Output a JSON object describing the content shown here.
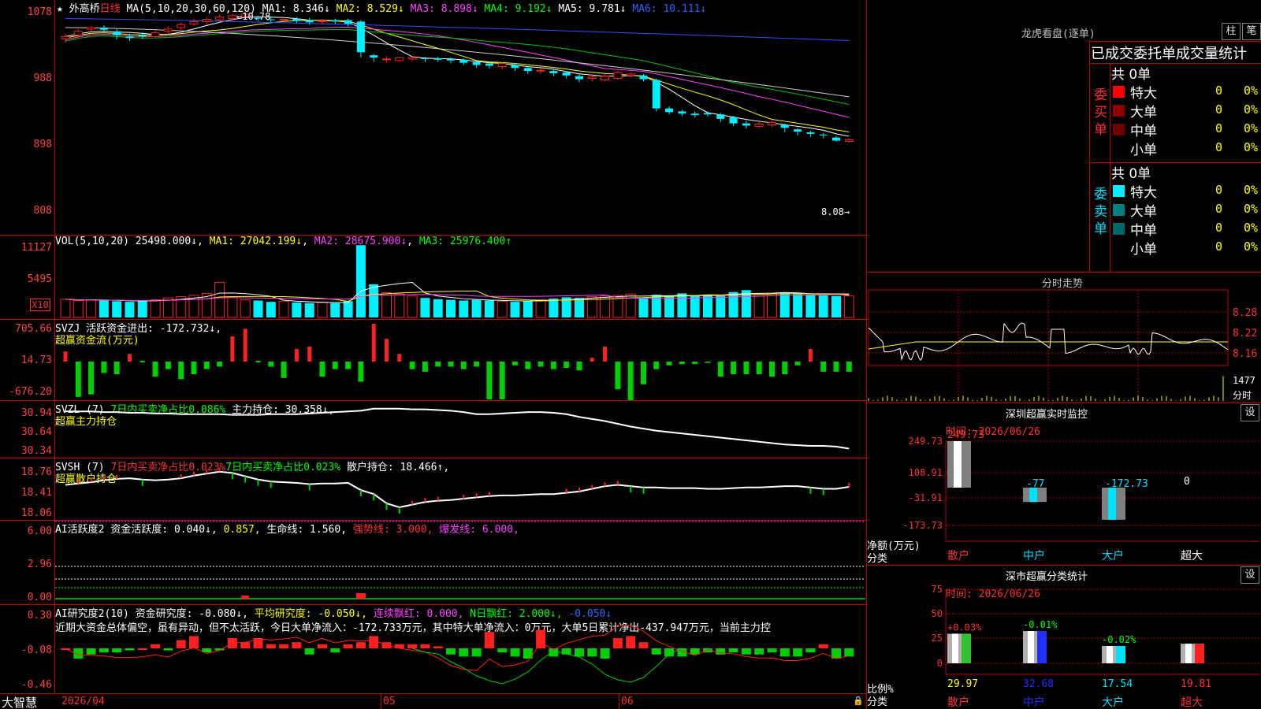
{
  "stock": {
    "star": "★",
    "name": "外高桥",
    "period": "日线",
    "ma_label": "MA(5,10,20,30,60,120)",
    "ma1": "MA1: 8.346↓",
    "ma2": "MA2: 8.529↓",
    "ma3": "MA3: 8.898↓",
    "ma4": "MA4: 9.192↓",
    "ma5": "MA5: 9.781↓",
    "ma6": "MA6: 10.111↓",
    "high_label": "10.78",
    "low_label": "8.08",
    "axis": [
      "1078",
      "988",
      "898",
      "808"
    ]
  },
  "colors": {
    "up": "#ff2020",
    "down": "#00f0ff",
    "ma1": "#ffffff",
    "ma2": "#ffff00",
    "ma3": "#ff40ff",
    "ma4": "#00c000",
    "ma5": "#d0d0d0",
    "ma6": "#3050ff"
  },
  "candles": {
    "open": [
      10.45,
      10.5,
      10.58,
      10.6,
      10.55,
      10.48,
      10.5,
      10.48,
      10.55,
      10.6,
      10.65,
      10.68,
      10.7,
      10.72,
      10.75,
      10.73,
      10.71,
      10.7,
      10.72,
      10.7,
      10.68,
      10.7,
      10.7,
      10.68,
      10.23,
      10.18,
      10.16,
      10.18,
      10.19,
      10.19,
      10.18,
      10.17,
      10.14,
      10.12,
      10.08,
      10.1,
      10.06,
      10.03,
      10.02,
      10.0,
      9.95,
      9.92,
      9.9,
      9.92,
      9.96,
      9.96,
      9.9,
      9.52,
      9.48,
      9.45,
      9.46,
      9.44,
      9.4,
      9.32,
      9.28,
      9.3,
      9.3,
      9.24,
      9.2,
      9.17,
      9.13,
      9.08
    ],
    "close": [
      10.48,
      10.55,
      10.6,
      10.57,
      10.5,
      10.46,
      10.48,
      10.53,
      10.58,
      10.64,
      10.68,
      10.71,
      10.74,
      10.76,
      10.78,
      10.72,
      10.7,
      10.71,
      10.69,
      10.67,
      10.69,
      10.68,
      10.65,
      10.27,
      10.2,
      10.18,
      10.2,
      10.2,
      10.18,
      10.17,
      10.16,
      10.13,
      10.1,
      10.09,
      10.12,
      10.06,
      10.02,
      10.03,
      9.99,
      9.96,
      9.91,
      9.94,
      9.95,
      10.0,
      9.98,
      9.91,
      9.52,
      9.47,
      9.45,
      9.43,
      9.44,
      9.38,
      9.32,
      9.29,
      9.31,
      9.33,
      9.26,
      9.21,
      9.18,
      9.16,
      9.09,
      9.1
    ],
    "high": [
      10.52,
      10.58,
      10.62,
      10.63,
      10.58,
      10.52,
      10.54,
      10.56,
      10.62,
      10.67,
      10.72,
      10.74,
      10.78,
      10.78,
      10.78,
      10.76,
      10.74,
      10.74,
      10.74,
      10.73,
      10.72,
      10.72,
      10.72,
      10.7,
      10.25,
      10.22,
      10.21,
      10.22,
      10.21,
      10.21,
      10.2,
      10.19,
      10.17,
      10.14,
      10.14,
      10.12,
      10.08,
      10.06,
      10.04,
      10.02,
      9.98,
      9.97,
      9.98,
      10.02,
      10.0,
      9.98,
      9.92,
      9.55,
      9.5,
      9.48,
      9.48,
      9.46,
      9.42,
      9.36,
      9.34,
      9.36,
      9.32,
      9.26,
      9.22,
      9.19,
      9.15,
      9.12
    ],
    "low": [
      10.4,
      10.45,
      10.54,
      10.55,
      10.44,
      10.42,
      10.45,
      10.46,
      10.52,
      10.57,
      10.62,
      10.64,
      10.67,
      10.69,
      10.7,
      10.69,
      10.66,
      10.67,
      10.66,
      10.64,
      10.64,
      10.65,
      10.62,
      10.2,
      10.14,
      10.13,
      10.14,
      10.15,
      10.14,
      10.14,
      10.12,
      10.1,
      10.06,
      10.05,
      10.04,
      10.02,
      9.98,
      9.98,
      9.95,
      9.92,
      9.87,
      9.88,
      9.88,
      9.9,
      9.93,
      9.88,
      9.48,
      9.44,
      9.42,
      9.4,
      9.41,
      9.34,
      9.28,
      9.25,
      9.26,
      9.27,
      9.2,
      9.16,
      9.14,
      9.12,
      9.08,
      9.06
    ]
  },
  "vol": {
    "label": "VOL(5,10,20)",
    "value": "25498.000↓",
    "ma1": "MA1: 27042.199↓",
    "ma2": "MA2: 28675.900↓",
    "ma3": "MA3: 25976.400↑",
    "axis": [
      "11127",
      "5495"
    ],
    "unit": "X10",
    "values": [
      2800,
      2600,
      2700,
      2600,
      2500,
      2400,
      2600,
      2700,
      3000,
      3200,
      3400,
      3700,
      5400,
      3100,
      2700,
      2600,
      2400,
      2500,
      2300,
      2200,
      2300,
      2200,
      2500,
      11100,
      5100,
      3800,
      3600,
      3300,
      3000,
      2800,
      2700,
      2600,
      2700,
      2600,
      2500,
      2400,
      2500,
      2700,
      2900,
      3100,
      3000,
      3200,
      3300,
      3400,
      3600,
      2900,
      3500,
      3300,
      3700,
      3400,
      3500,
      3300,
      3900,
      4200,
      3600,
      3700,
      3800,
      3600,
      3500,
      3400,
      3300,
      3300
    ]
  },
  "svzj": {
    "label": "SVZJ",
    "text": "活跃资金进出: -172.732↓,",
    "title": "超赢资金流(万元)",
    "axis": [
      "705.66",
      "14.73",
      "-676.20"
    ],
    "values": [
      80,
      -280,
      -260,
      -90,
      -100,
      60,
      0,
      -120,
      -60,
      -140,
      -100,
      -60,
      -40,
      200,
      260,
      0,
      -40,
      -130,
      100,
      120,
      -120,
      -60,
      -60,
      -160,
      300,
      180,
      60,
      -60,
      -80,
      -40,
      -40,
      -60,
      -40,
      -300,
      -300,
      -30,
      -60,
      -40,
      -60,
      -50,
      -70,
      30,
      120,
      -220,
      -320,
      -180,
      -60,
      -30,
      -20,
      -20,
      -10,
      -120,
      -100,
      -100,
      -100,
      -120,
      -100,
      -30,
      100,
      -80,
      -80,
      -80
    ]
  },
  "svzl": {
    "label": "SVZL (7)",
    "text1": "7日内买卖净占比0.086%",
    "text2": "主力持仓: 30.358↓,",
    "title": "超赢主力持仓",
    "axis": [
      "30.94",
      "30.64",
      "30.34"
    ],
    "values": [
      30.9,
      30.9,
      30.9,
      30.89,
      30.89,
      30.88,
      30.88,
      30.87,
      30.87,
      30.86,
      30.86,
      30.86,
      30.86,
      30.85,
      30.85,
      30.85,
      30.86,
      30.86,
      30.86,
      30.87,
      30.88,
      30.89,
      30.9,
      30.91,
      30.94,
      30.94,
      30.94,
      30.93,
      30.93,
      30.92,
      30.91,
      30.89,
      30.86,
      30.86,
      30.87,
      30.88,
      30.89,
      30.89,
      30.88,
      30.86,
      30.82,
      30.79,
      30.76,
      30.72,
      30.68,
      30.65,
      30.62,
      30.6,
      30.58,
      30.56,
      30.54,
      30.52,
      30.5,
      30.48,
      30.46,
      30.44,
      30.42,
      30.41,
      30.4,
      30.4,
      30.39,
      30.36
    ]
  },
  "svsh": {
    "label": "SVSH (7)",
    "text1": "7日内买卖净占比0.023%",
    "text2": "7日内买卖净占比0.023%",
    "text3": "散户持仓: 18.466↑,",
    "title": "超赢散户持仓",
    "axis": [
      "18.76",
      "18.41",
      "18.06"
    ],
    "values": [
      18.5,
      18.52,
      18.54,
      18.57,
      18.59,
      18.6,
      18.58,
      18.57,
      18.58,
      18.6,
      18.64,
      18.67,
      18.7,
      18.68,
      18.63,
      18.58,
      18.55,
      18.54,
      18.53,
      18.51,
      18.52,
      18.52,
      18.53,
      18.42,
      18.36,
      18.22,
      18.16,
      18.2,
      18.24,
      18.26,
      18.27,
      18.29,
      18.31,
      18.33,
      18.34,
      18.34,
      18.35,
      18.36,
      18.36,
      18.38,
      18.4,
      18.44,
      18.48,
      18.5,
      18.48,
      18.46,
      18.46,
      18.45,
      18.45,
      18.45,
      18.44,
      18.44,
      18.45,
      18.46,
      18.46,
      18.47,
      18.48,
      18.48,
      18.46,
      18.44,
      18.44,
      18.47
    ]
  },
  "ai1": {
    "label": "AI活跃度2",
    "t1": "资金活跃度: 0.040↓,",
    "t2": "0.857,",
    "t3": "生命线: 1.560,",
    "t4": "强势线: 3.000,",
    "t5": "爆发线: 6.000,",
    "axis": [
      "6.00",
      "2.96",
      "0.00"
    ]
  },
  "ai2": {
    "label": "AI研究度2(10)",
    "t1": "资金研究度: -0.080↓,",
    "t2": "平均研究度: -0.050↓,",
    "t3": "连续飘红: 0.000,",
    "t4": "N日飘红: 2.000↓,",
    "t5": "-0.050↓",
    "desc": "近期大资金总体偏空，虽有异动，但不太活跃，今日大单净流入：-172.733万元，其中特大单净流入：0万元，大单5日累计净出-437.947万元，当前主力控",
    "axis": [
      "0.30",
      "-0.08",
      "-0.46"
    ],
    "values": [
      0.0,
      -0.05,
      -0.03,
      -0.02,
      -0.02,
      -0.01,
      0.0,
      0.02,
      -0.01,
      0.04,
      0.06,
      -0.02,
      -0.01,
      0.05,
      0.03,
      0.05,
      0.02,
      0.02,
      0.03,
      -0.03,
      0.02,
      -0.02,
      0.02,
      0.03,
      0.06,
      0.03,
      0.02,
      0.02,
      0.02,
      0.01,
      -0.03,
      -0.04,
      -0.04,
      0.08,
      -0.02,
      -0.04,
      -0.05,
      0.09,
      -0.04,
      -0.03,
      -0.04,
      -0.04,
      -0.05,
      0.05,
      0.06,
      0.03,
      -0.03,
      -0.04,
      -0.04,
      -0.03,
      -0.02,
      -0.03,
      -0.02,
      -0.03,
      -0.03,
      -0.02,
      -0.04,
      -0.04,
      -0.02,
      0.02,
      -0.05,
      -0.04
    ]
  },
  "footer": {
    "brand": "大智慧",
    "d1": "2026/04",
    "d2": "05",
    "d3": "06"
  },
  "lhkp": {
    "title": "龙虎看盘(逐单)",
    "btn1": "柱",
    "btn2": "笔",
    "header": "已成交委托单成交量统计",
    "buy_label": "委买单",
    "sell_label": "委卖单",
    "buy_total": "共 0单",
    "sell_total": "共 0单",
    "buy_rows": [
      {
        "name": "特大",
        "count": "0",
        "pct": "0%"
      },
      {
        "name": "大单",
        "count": "0",
        "pct": "0%"
      },
      {
        "name": "中单",
        "count": "0",
        "pct": "0%"
      },
      {
        "name": "小单",
        "count": "0",
        "pct": "0%"
      }
    ],
    "sell_rows": [
      {
        "name": "特大",
        "count": "0",
        "pct": "0%"
      },
      {
        "name": "大单",
        "count": "0",
        "pct": "0%"
      },
      {
        "name": "中单",
        "count": "0",
        "pct": "0%"
      },
      {
        "name": "小单",
        "count": "0",
        "pct": "0%"
      }
    ],
    "buy_colors": [
      "#ff0000",
      "#900000",
      "#700000",
      "#000000"
    ],
    "sell_colors": [
      "#00f0ff",
      "#008080",
      "#006868",
      "#000000"
    ]
  },
  "fszs": {
    "title": "分时走势",
    "axis": [
      "8.28",
      "8.22",
      "8.16"
    ],
    "vol_label": "1477",
    "fs_label": "分时"
  },
  "szcy": {
    "title": "深圳超赢实时监控",
    "btn": "设",
    "time": "时间: 2026/06/26",
    "axis": [
      "249.73",
      "108.91",
      "-31.91",
      "-173.73"
    ],
    "unit": "净额(万元)",
    "cat_label": "分类",
    "values": [
      249.73,
      -77,
      -172.73,
      0
    ],
    "labels": [
      "249.73",
      "-77",
      "-172.73",
      "0"
    ],
    "cats": [
      "散户",
      "中户",
      "大户",
      "超大"
    ]
  },
  "sscy": {
    "title": "深市超赢分类统计",
    "btn": "设",
    "time": "时间: 2026/06/26",
    "axis": [
      "75",
      "50",
      "25",
      "0"
    ],
    "unit": "比例%",
    "cat_label": "分类",
    "values": [
      29.97,
      32.68,
      17.54,
      19.81
    ],
    "labels": [
      "29.97",
      "32.68",
      "17.54",
      "19.81"
    ],
    "changes": [
      "+0.03%",
      "-0.01%",
      "-0.02%",
      ""
    ],
    "cats": [
      "散户",
      "中户",
      "大户",
      "超大"
    ],
    "bar_colors": [
      "#30c030",
      "#2030ff",
      "#00e0ff",
      "#ff2020"
    ]
  }
}
